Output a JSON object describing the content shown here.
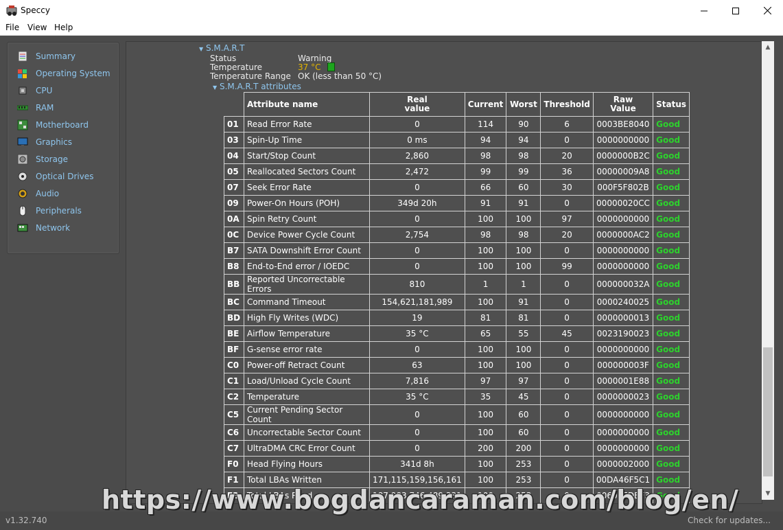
{
  "window": {
    "title": "Speccy",
    "minimize_icon": "minimize-icon",
    "maximize_icon": "maximize-icon",
    "close_icon": "close-icon"
  },
  "menu": [
    "File",
    "View",
    "Help"
  ],
  "sidebar": {
    "items": [
      {
        "label": "Summary",
        "icon": "summary-icon"
      },
      {
        "label": "Operating System",
        "icon": "windows-icon"
      },
      {
        "label": "CPU",
        "icon": "cpu-icon"
      },
      {
        "label": "RAM",
        "icon": "ram-icon"
      },
      {
        "label": "Motherboard",
        "icon": "motherboard-icon"
      },
      {
        "label": "Graphics",
        "icon": "monitor-icon"
      },
      {
        "label": "Storage",
        "icon": "hard-drive-icon"
      },
      {
        "label": "Optical Drives",
        "icon": "disc-icon"
      },
      {
        "label": "Audio",
        "icon": "speaker-icon"
      },
      {
        "label": "Peripherals",
        "icon": "mouse-icon"
      },
      {
        "label": "Network",
        "icon": "network-icon"
      }
    ]
  },
  "smart": {
    "section_title": "S.M.A.R.T",
    "status_label": "Status",
    "status_value": "Warning",
    "temperature_label": "Temperature",
    "temperature_value": "37 °C",
    "temperature_range_label": "Temperature Range",
    "temperature_range_value": "OK (less than 50 °C)",
    "attributes_title": "S.M.A.R.T attributes",
    "headers": {
      "name": "Attribute name",
      "real_1": "Real",
      "real_2": "value",
      "current": "Current",
      "worst": "Worst",
      "threshold": "Threshold",
      "raw_1": "Raw",
      "raw_2": "Value",
      "status": "Status"
    },
    "rows": [
      {
        "id": "01",
        "name": "Read Error Rate",
        "real": "0",
        "current": "114",
        "worst": "90",
        "threshold": "6",
        "raw": "0003BE8040",
        "status": "Good"
      },
      {
        "id": "03",
        "name": "Spin-Up Time",
        "real": "0 ms",
        "current": "94",
        "worst": "94",
        "threshold": "0",
        "raw": "0000000000",
        "status": "Good"
      },
      {
        "id": "04",
        "name": "Start/Stop Count",
        "real": "2,860",
        "current": "98",
        "worst": "98",
        "threshold": "20",
        "raw": "0000000B2C",
        "status": "Good"
      },
      {
        "id": "05",
        "name": "Reallocated Sectors Count",
        "real": "2,472",
        "current": "99",
        "worst": "99",
        "threshold": "36",
        "raw": "00000009A8",
        "status": "Good"
      },
      {
        "id": "07",
        "name": "Seek Error Rate",
        "real": "0",
        "current": "66",
        "worst": "60",
        "threshold": "30",
        "raw": "000F5F802B",
        "status": "Good"
      },
      {
        "id": "09",
        "name": "Power-On Hours (POH)",
        "real": "349d 20h",
        "current": "91",
        "worst": "91",
        "threshold": "0",
        "raw": "00000020CC",
        "status": "Good"
      },
      {
        "id": "0A",
        "name": "Spin Retry Count",
        "real": "0",
        "current": "100",
        "worst": "100",
        "threshold": "97",
        "raw": "0000000000",
        "status": "Good"
      },
      {
        "id": "0C",
        "name": "Device Power Cycle Count",
        "real": "2,754",
        "current": "98",
        "worst": "98",
        "threshold": "20",
        "raw": "0000000AC2",
        "status": "Good"
      },
      {
        "id": "B7",
        "name": "SATA Downshift Error Count",
        "real": "0",
        "current": "100",
        "worst": "100",
        "threshold": "0",
        "raw": "0000000000",
        "status": "Good"
      },
      {
        "id": "B8",
        "name": "End-to-End error / IOEDC",
        "real": "0",
        "current": "100",
        "worst": "100",
        "threshold": "99",
        "raw": "0000000000",
        "status": "Good"
      },
      {
        "id": "BB",
        "name": "Reported Uncorrectable Errors",
        "real": "810",
        "current": "1",
        "worst": "1",
        "threshold": "0",
        "raw": "000000032A",
        "status": "Good"
      },
      {
        "id": "BC",
        "name": "Command Timeout",
        "real": "154,621,181,989",
        "current": "100",
        "worst": "91",
        "threshold": "0",
        "raw": "0000240025",
        "status": "Good"
      },
      {
        "id": "BD",
        "name": "High Fly Writes (WDC)",
        "real": "19",
        "current": "81",
        "worst": "81",
        "threshold": "0",
        "raw": "0000000013",
        "status": "Good"
      },
      {
        "id": "BE",
        "name": "Airflow Temperature",
        "real": "35 °C",
        "current": "65",
        "worst": "55",
        "threshold": "45",
        "raw": "0023190023",
        "status": "Good"
      },
      {
        "id": "BF",
        "name": "G-sense error rate",
        "real": "0",
        "current": "100",
        "worst": "100",
        "threshold": "0",
        "raw": "0000000000",
        "status": "Good"
      },
      {
        "id": "C0",
        "name": "Power-off Retract Count",
        "real": "63",
        "current": "100",
        "worst": "100",
        "threshold": "0",
        "raw": "000000003F",
        "status": "Good"
      },
      {
        "id": "C1",
        "name": "Load/Unload Cycle Count",
        "real": "7,816",
        "current": "97",
        "worst": "97",
        "threshold": "0",
        "raw": "0000001E88",
        "status": "Good"
      },
      {
        "id": "C2",
        "name": "Temperature",
        "real": "35 °C",
        "current": "35",
        "worst": "45",
        "threshold": "0",
        "raw": "0000000023",
        "status": "Good"
      },
      {
        "id": "C5",
        "name": "Current Pending Sector Count",
        "real": "0",
        "current": "100",
        "worst": "60",
        "threshold": "0",
        "raw": "0000000000",
        "status": "Good"
      },
      {
        "id": "C6",
        "name": "Uncorrectable Sector Count",
        "real": "0",
        "current": "100",
        "worst": "60",
        "threshold": "0",
        "raw": "0000000000",
        "status": "Good"
      },
      {
        "id": "C7",
        "name": "UltraDMA CRC Error Count",
        "real": "0",
        "current": "200",
        "worst": "200",
        "threshold": "0",
        "raw": "0000000000",
        "status": "Good"
      },
      {
        "id": "F0",
        "name": "Head Flying Hours",
        "real": "341d 8h",
        "current": "100",
        "worst": "253",
        "threshold": "0",
        "raw": "0000002000",
        "status": "Good"
      },
      {
        "id": "F1",
        "name": "Total LBAs Written",
        "real": "171,115,159,156,161",
        "current": "100",
        "worst": "253",
        "threshold": "0",
        "raw": "00DA46F5C1",
        "status": "Good"
      },
      {
        "id": "F2",
        "name": "Total LBAs Read",
        "real": "187,983,746,489,331",
        "current": "100",
        "worst": "253",
        "threshold": "0",
        "raw": "00606EDBF3",
        "status": "Good"
      }
    ]
  },
  "statusbar": {
    "version": "v1.32.740",
    "check_updates": "Check for updates..."
  },
  "watermark": "https://www.bogdancaraman.com/blog/en/",
  "colors": {
    "link": "#8fc6ee",
    "warning_temp": "#e3b400",
    "good": "#2dd12d",
    "background": "#4b4b4b"
  }
}
